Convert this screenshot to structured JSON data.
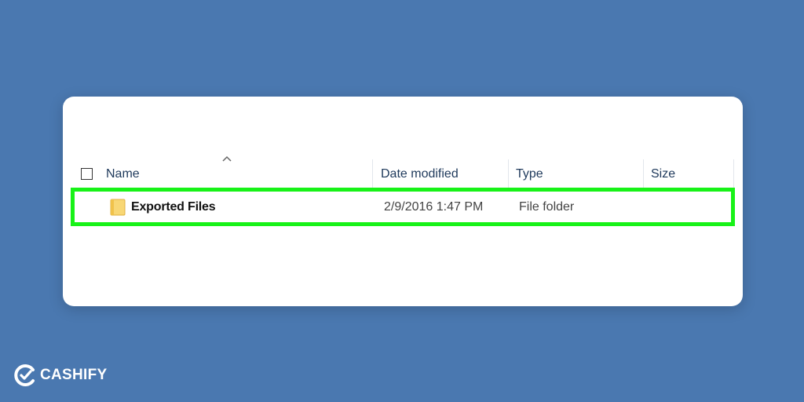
{
  "explorer": {
    "columns": {
      "name": "Name",
      "date_modified": "Date modified",
      "type": "Type",
      "size": "Size"
    },
    "sort": {
      "column": "name",
      "direction": "ascending"
    },
    "rows": [
      {
        "name": "Exported Files",
        "date_modified": "2/9/2016 1:47 PM",
        "type": "File folder",
        "size": "",
        "icon": "folder-icon",
        "highlighted": true
      }
    ]
  },
  "highlight": {
    "color": "#18f218"
  },
  "branding": {
    "logo_text": "CASHIFY",
    "background_color": "#4a78b0"
  }
}
